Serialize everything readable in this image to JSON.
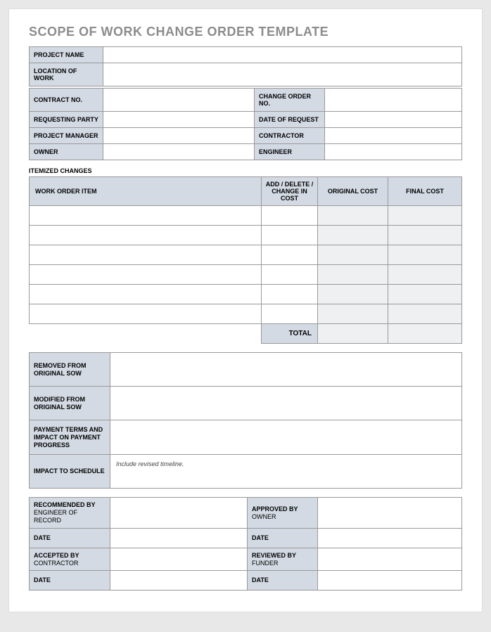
{
  "title": "SCOPE OF WORK CHANGE ORDER TEMPLATE",
  "header": {
    "project_name_label": "PROJECT NAME",
    "project_name": "",
    "location_label": "LOCATION OF WORK",
    "location": "",
    "contract_no_label": "CONTRACT NO.",
    "contract_no": "",
    "change_order_no_label": "CHANGE ORDER NO.",
    "change_order_no": "",
    "requesting_party_label": "REQUESTING PARTY",
    "requesting_party": "",
    "date_of_request_label": "DATE OF REQUEST",
    "date_of_request": "",
    "project_manager_label": "PROJECT MANAGER",
    "project_manager": "",
    "contractor_label": "CONTRACTOR",
    "contractor": "",
    "owner_label": "OWNER",
    "owner": "",
    "engineer_label": "ENGINEER",
    "engineer": ""
  },
  "itemized": {
    "section_label": "ITEMIZED CHANGES",
    "col_work_order": "WORK ORDER ITEM",
    "col_add_delete": "ADD / DELETE / CHANGE IN COST",
    "col_original": "ORIGINAL COST",
    "col_final": "FINAL COST",
    "rows": [
      {
        "item": "",
        "change": "",
        "original": "",
        "final": ""
      },
      {
        "item": "",
        "change": "",
        "original": "",
        "final": ""
      },
      {
        "item": "",
        "change": "",
        "original": "",
        "final": ""
      },
      {
        "item": "",
        "change": "",
        "original": "",
        "final": ""
      },
      {
        "item": "",
        "change": "",
        "original": "",
        "final": ""
      },
      {
        "item": "",
        "change": "",
        "original": "",
        "final": ""
      }
    ],
    "total_label": "TOTAL",
    "total_original": "",
    "total_final": ""
  },
  "notes": {
    "removed_label": "REMOVED FROM ORIGINAL SOW",
    "removed": "",
    "modified_label": "MODIFIED FROM ORIGINAL SOW",
    "modified": "",
    "payment_label": "PAYMENT TERMS AND IMPACT ON PAYMENT PROGRESS",
    "payment": "",
    "schedule_label": "IMPACT TO SCHEDULE",
    "schedule": "Include revised timeline."
  },
  "signatures": {
    "recommended_label": "RECOMMENDED BY",
    "recommended_sub": "ENGINEER OF RECORD",
    "recommended": "",
    "approved_label": "APPROVED BY",
    "approved_sub": "OWNER",
    "approved": "",
    "date1_label": "DATE",
    "date1a": "",
    "date1b": "",
    "accepted_label": "ACCEPTED BY",
    "accepted_sub": "CONTRACTOR",
    "accepted": "",
    "reviewed_label": "REVIEWED BY",
    "reviewed_sub": "FUNDER",
    "reviewed": "",
    "date2_label": "DATE",
    "date2a": "",
    "date2b": ""
  }
}
